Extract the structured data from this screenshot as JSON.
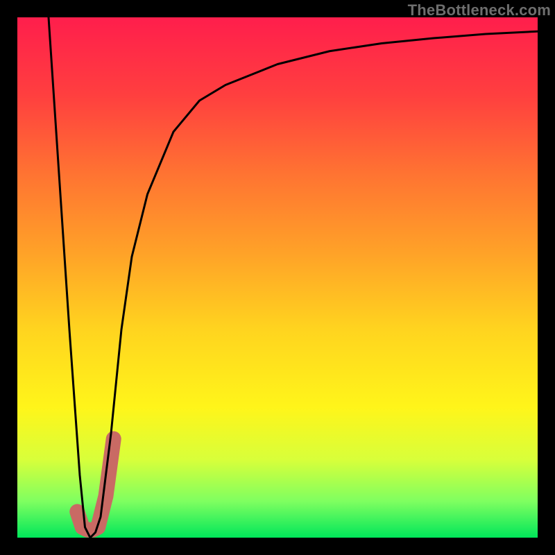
{
  "watermark": "TheBottleneck.com",
  "chart_data": {
    "type": "line",
    "title": "",
    "xlabel": "",
    "ylabel": "",
    "xlim": [
      0,
      100
    ],
    "ylim": [
      0,
      100
    ],
    "gradient_colors": {
      "top": "#ff1e4c",
      "mid": "#ffd41f",
      "bottom": "#00e65a"
    },
    "series": [
      {
        "name": "bottleneck-curve",
        "color": "#000000",
        "stroke_width": 3,
        "x": [
          6,
          8,
          10,
          12,
          13,
          14,
          15,
          16,
          18,
          20,
          22,
          25,
          30,
          35,
          40,
          50,
          60,
          70,
          80,
          90,
          100
        ],
        "values": [
          100,
          70,
          40,
          12,
          2,
          0,
          1,
          4,
          20,
          40,
          54,
          66,
          78,
          84,
          87,
          91,
          93.5,
          95,
          96,
          96.8,
          97.3
        ]
      },
      {
        "name": "highlight-segment",
        "color": "#c96a64",
        "stroke_width": 22,
        "x": [
          11.5,
          12.5,
          13.5,
          14.5,
          15.5,
          17,
          18.5
        ],
        "values": [
          5,
          2,
          1.5,
          1.5,
          2,
          8,
          19
        ]
      }
    ],
    "marker": {
      "name": "highlight-dot",
      "color": "#c96a64",
      "radius": 10,
      "x": 11.5,
      "y": 5
    }
  }
}
